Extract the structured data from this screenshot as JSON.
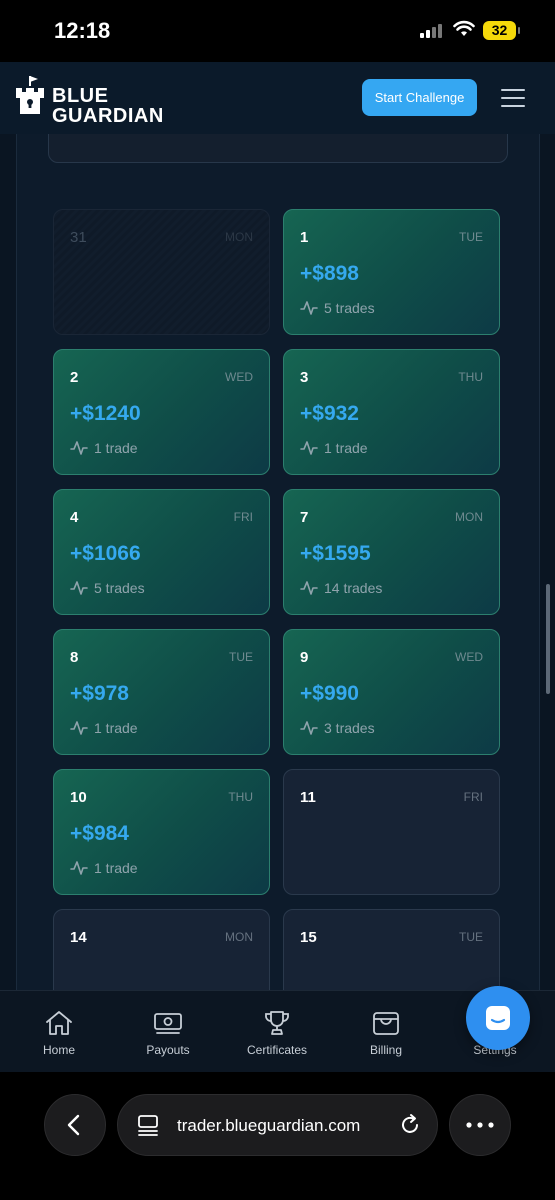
{
  "status_bar": {
    "time": "12:18",
    "battery": "32"
  },
  "header": {
    "brand_line1": "BLUE",
    "brand_line2": "GUARDIAN",
    "start_button": "Start Challenge"
  },
  "colors": {
    "accent": "#35a7f2",
    "profit_text": "#35a9ef",
    "profit_card": "#166552"
  },
  "calendar": {
    "days": [
      {
        "day": "31",
        "dow": "MON",
        "amount": "",
        "trades": ""
      },
      {
        "day": "1",
        "dow": "TUE",
        "amount": "+$898",
        "trades": "5 trades"
      },
      {
        "day": "2",
        "dow": "WED",
        "amount": "+$1240",
        "trades": "1 trade"
      },
      {
        "day": "3",
        "dow": "THU",
        "amount": "+$932",
        "trades": "1 trade"
      },
      {
        "day": "4",
        "dow": "FRI",
        "amount": "+$1066",
        "trades": "5 trades"
      },
      {
        "day": "7",
        "dow": "MON",
        "amount": "+$1595",
        "trades": "14 trades"
      },
      {
        "day": "8",
        "dow": "TUE",
        "amount": "+$978",
        "trades": "1 trade"
      },
      {
        "day": "9",
        "dow": "WED",
        "amount": "+$990",
        "trades": "3 trades"
      },
      {
        "day": "10",
        "dow": "THU",
        "amount": "+$984",
        "trades": "1 trade"
      },
      {
        "day": "11",
        "dow": "FRI",
        "amount": "",
        "trades": ""
      },
      {
        "day": "14",
        "dow": "MON",
        "amount": "",
        "trades": ""
      },
      {
        "day": "15",
        "dow": "TUE",
        "amount": "",
        "trades": ""
      }
    ]
  },
  "bottom_nav": {
    "items": [
      {
        "label": "Home",
        "icon": "home-icon"
      },
      {
        "label": "Payouts",
        "icon": "money-icon"
      },
      {
        "label": "Certificates",
        "icon": "trophy-icon"
      },
      {
        "label": "Billing",
        "icon": "wallet-icon"
      },
      {
        "label": "Settings",
        "icon": "gear-icon"
      }
    ]
  },
  "browser": {
    "url": "trader.blueguardian.com"
  }
}
